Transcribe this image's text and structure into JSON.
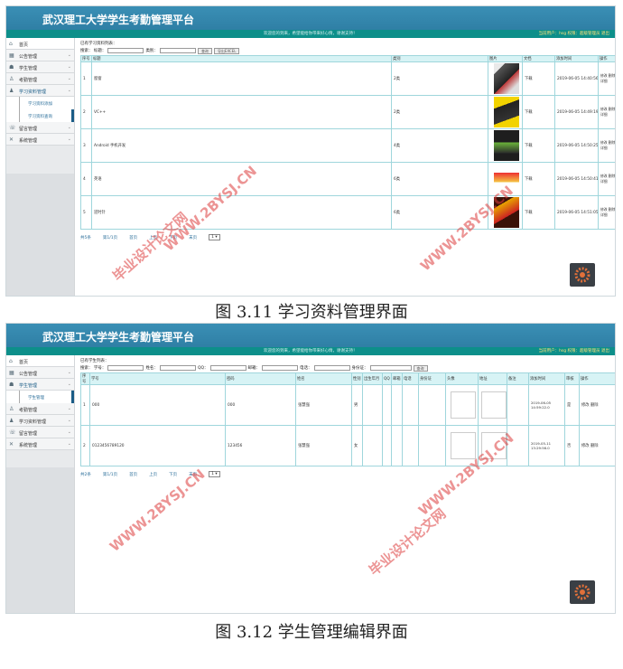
{
  "platform_title": "武汉理工大学学生考勤管理平台",
  "welcome": "欢迎您的到来，希望能给你带来好心情，谢谢支持！",
  "user_info": "当前用户：hsg 权限：超级管理员 退出",
  "nav": {
    "home": "首页",
    "notice": "公告管理",
    "student": "学生管理",
    "attendance": "考勤管理",
    "material": "学习资料管理",
    "message": "留言管理",
    "system": "系统管理",
    "material_add": "学习资料添加",
    "material_query": "学习资料查询",
    "student_sub": "学生管理"
  },
  "fig1": {
    "crumb": "已有学习资料列表：",
    "search_title": "搜索：  标题：",
    "search_cat": "类别：",
    "search_btn": "查询",
    "export_btn": "导出EXCEL",
    "headers": [
      "序号",
      "标题",
      "类别",
      "图片",
      "文档",
      "添加时间",
      "操作"
    ],
    "rows": [
      {
        "no": "1",
        "title": "窗窗",
        "cat": "2类",
        "doc": "下载",
        "time": "2019-06-05 14:40:56.0",
        "ops": "修改 删除 详细"
      },
      {
        "no": "2",
        "title": "VC++",
        "cat": "2类",
        "doc": "下载",
        "time": "2019-06-05 14:49:19.0",
        "ops": "修改 删除 详细"
      },
      {
        "no": "3",
        "title": "Android 手机开发",
        "cat": "4类",
        "doc": "下载",
        "time": "2019-06-05 14:50:25.0",
        "ops": "修改 删除 详细"
      },
      {
        "no": "4",
        "title": "英语",
        "cat": "6类",
        "doc": "下载",
        "time": "2019-06-05 14:50:41.0",
        "ops": "修改 删除 详细"
      },
      {
        "no": "5",
        "title": "逆时针",
        "cat": "6类",
        "doc": "下载",
        "time": "2019-06-05 14:51:05.0",
        "ops": "修改 删除 详细"
      }
    ],
    "pager": [
      "共5条",
      "第1/1页",
      "首页",
      "上页",
      "下页",
      "末页",
      "1 ▾"
    ],
    "caption": "图 3.11 学习资料管理界面"
  },
  "fig2": {
    "crumb": "已有学生列表：",
    "search": [
      "搜索：  学号：",
      "姓名：",
      "QQ：",
      "邮箱：",
      "电话：",
      "身份证："
    ],
    "search_btn": "查询",
    "headers": [
      "序号",
      "学号",
      "密码",
      "姓名",
      "性别",
      "出生年月",
      "QQ",
      "邮箱",
      "电话",
      "身份证",
      "头像",
      "地址",
      "备注",
      "添加时间",
      "审核",
      "操作"
    ],
    "rows": [
      {
        "no": "1",
        "sid": "000",
        "pwd": "000",
        "name": "张慧强",
        "sex": "男",
        "time": "2019-06-05 14:59:22.0",
        "audit": "是",
        "ops": "修改 删除"
      },
      {
        "no": "2",
        "sid": "0123456789120",
        "pwd": "123456",
        "name": "张慧强",
        "sex": "女",
        "time": "2019-05-11 13:29:56.0",
        "audit": "否",
        "ops": "修改 删除"
      }
    ],
    "pager": [
      "共2条",
      "第1/1页",
      "首页",
      "上页",
      "下页",
      "末页",
      "1 ▾"
    ],
    "caption": "图 3.12 学生管理编辑界面"
  },
  "watermark_url": "WWW.2BYSJ.CN",
  "watermark_site": "毕业设计论文网",
  "colors": {
    "title_bar": "#2f7fa5",
    "sub_bar": "#0d8f8a",
    "table_head": "#d7f3f5",
    "watermark": "#dc3c3c"
  }
}
